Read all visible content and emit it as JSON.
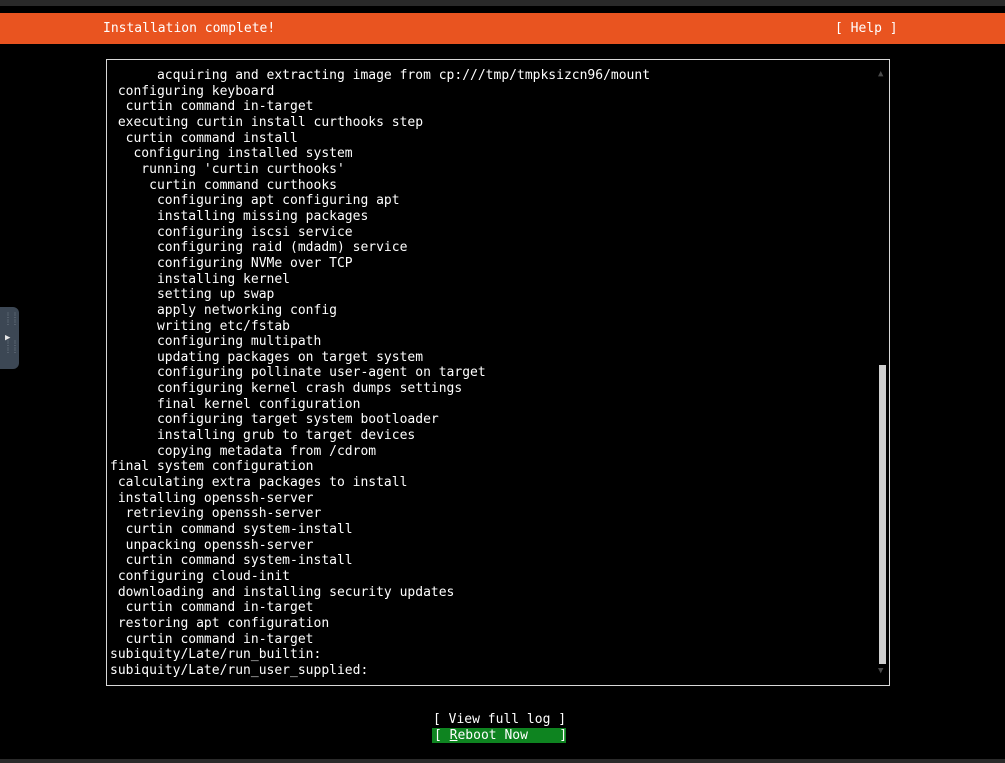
{
  "header": {
    "title": "Installation complete!",
    "help_label": "[ Help ]",
    "bar_color": "#e95420"
  },
  "log": {
    "lines": [
      "      acquiring and extracting image from cp:///tmp/tmpksizcn96/mount",
      " configuring keyboard",
      "  curtin command in-target",
      " executing curtin install curthooks step",
      "  curtin command install",
      "   configuring installed system",
      "    running 'curtin curthooks'",
      "     curtin command curthooks",
      "      configuring apt configuring apt",
      "      installing missing packages",
      "      configuring iscsi service",
      "      configuring raid (mdadm) service",
      "      configuring NVMe over TCP",
      "      installing kernel",
      "      setting up swap",
      "      apply networking config",
      "      writing etc/fstab",
      "      configuring multipath",
      "      updating packages on target system",
      "      configuring pollinate user-agent on target",
      "      configuring kernel crash dumps settings",
      "      final kernel configuration",
      "      configuring target system bootloader",
      "      installing grub to target devices",
      "      copying metadata from /cdrom",
      "final system configuration",
      " calculating extra packages to install",
      " installing openssh-server",
      "  retrieving openssh-server",
      "  curtin command system-install",
      "  unpacking openssh-server",
      "  curtin command system-install",
      " configuring cloud-init",
      " downloading and installing security updates",
      "  curtin command in-target",
      " restoring apt configuration",
      "  curtin command in-target",
      "subiquity/Late/run_builtin:",
      "subiquity/Late/run_user_supplied:"
    ],
    "scroll_up_icon": "triangle-up-icon",
    "scroll_down_icon": "triangle-down-icon"
  },
  "actions": {
    "view_log_label": "[ View full log ]",
    "reboot_prefix": "[ ",
    "reboot_hotkey": "R",
    "reboot_rest": "eboot Now    ]",
    "reboot_color": "#0e8420"
  },
  "side_handle": {
    "icon": "play-arrow-icon"
  }
}
